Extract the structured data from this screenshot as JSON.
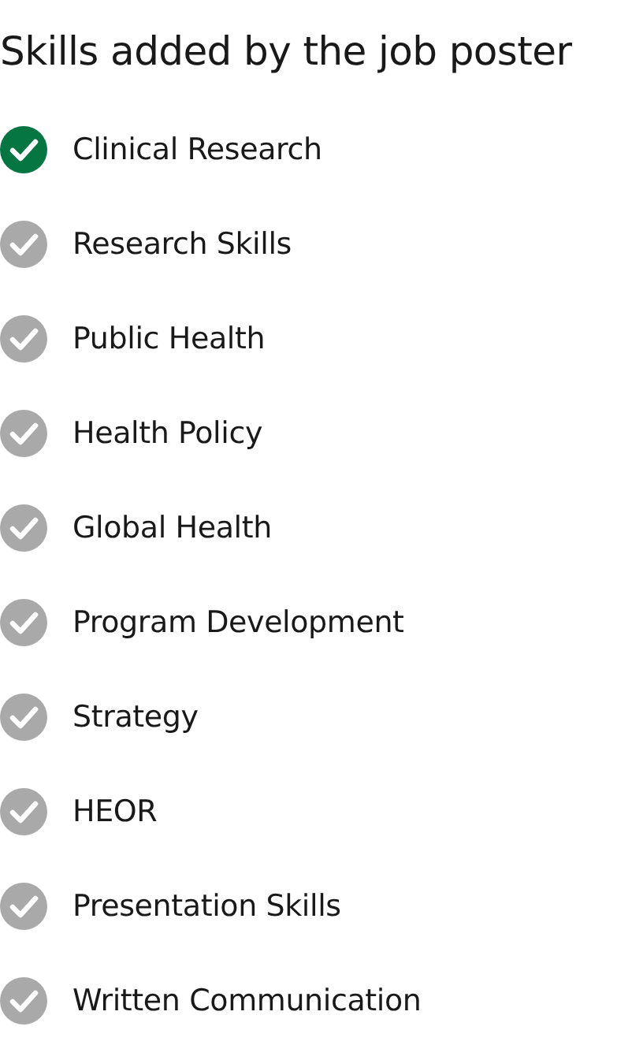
{
  "title": "Skills added by the job poster",
  "skills": [
    {
      "label": "Clinical Research",
      "checked": true
    },
    {
      "label": "Research Skills",
      "checked": false
    },
    {
      "label": "Public Health",
      "checked": false
    },
    {
      "label": "Health Policy",
      "checked": false
    },
    {
      "label": "Global Health",
      "checked": false
    },
    {
      "label": "Program Development",
      "checked": false
    },
    {
      "label": "Strategy",
      "checked": false
    },
    {
      "label": "HEOR",
      "checked": false
    },
    {
      "label": "Presentation Skills",
      "checked": false
    },
    {
      "label": "Written Communication",
      "checked": false
    }
  ]
}
